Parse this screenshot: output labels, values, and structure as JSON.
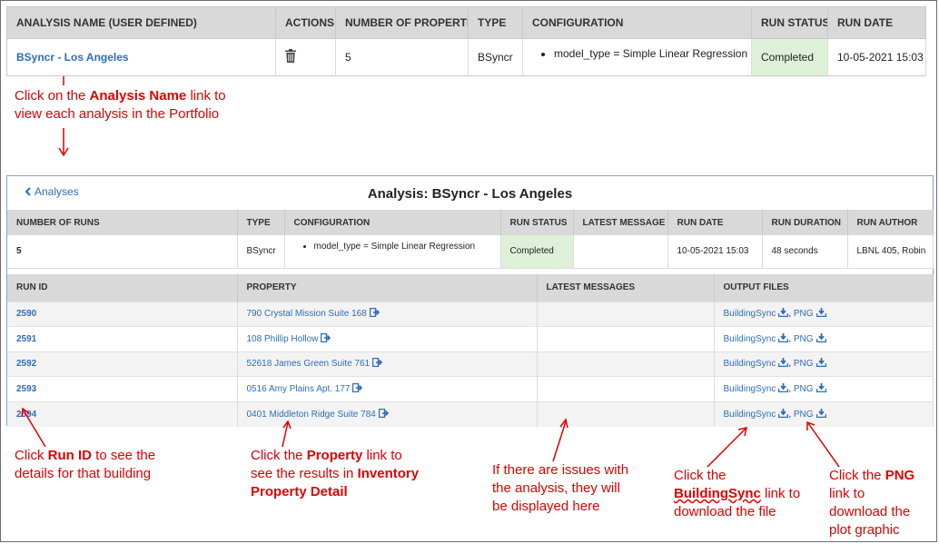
{
  "top_table": {
    "headers": [
      "ANALYSIS NAME (USER DEFINED)",
      "ACTIONS",
      "NUMBER OF PROPERTIES",
      "TYPE",
      "CONFIGURATION",
      "RUN STATUS",
      "RUN DATE"
    ],
    "row": {
      "name": "BSyncr - Los Angeles",
      "properties": "5",
      "type": "BSyncr",
      "configuration": "model_type = Simple Linear Regression",
      "status": "Completed",
      "date": "10-05-2021 15:03"
    }
  },
  "annotations": {
    "analysis_name": {
      "pre": "Click on the ",
      "bold": "Analysis Name",
      "post": " link to",
      "line2": "view each analysis in the Portfolio"
    },
    "run_id": {
      "pre": "Click ",
      "bold": "Run ID",
      "post": " to see the",
      "line2": "details for that building"
    },
    "property": {
      "pre": "Click the ",
      "bold": "Property",
      "post": " link to",
      "line2_pre": "see the results in ",
      "line2_bold": "Inventory",
      "line3_bold": "Property Detail"
    },
    "messages": {
      "line1": "If there are issues with",
      "line2": "the analysis, they will",
      "line3": "be displayed here"
    },
    "buildingsync": {
      "line1": "Click the",
      "line2_bold": "BuildingSync",
      "line2_post": " link to",
      "line3": "download the file"
    },
    "png": {
      "pre": "Click the ",
      "bold": "PNG",
      "line2": "link to",
      "line3": "download the",
      "line4": "plot graphic"
    }
  },
  "panel": {
    "back_label": "Analyses",
    "title": "Analysis: BSyncr - Los Angeles",
    "runs_headers": [
      "NUMBER OF RUNS",
      "TYPE",
      "CONFIGURATION",
      "RUN STATUS",
      "LATEST MESSAGE",
      "RUN DATE",
      "RUN DURATION",
      "RUN AUTHOR"
    ],
    "runs_row": {
      "runs": "5",
      "type": "BSyncr",
      "configuration": "model_type = Simple Linear Regression",
      "status": "Completed",
      "message": "",
      "date": "10-05-2021 15:03",
      "duration": "48 seconds",
      "author": "LBNL 405, Robin"
    },
    "files_headers": [
      "RUN ID",
      "PROPERTY",
      "LATEST MESSAGES",
      "OUTPUT FILES"
    ],
    "files_rows": [
      {
        "run_id": "2590",
        "property": "790 Crystal Mission Suite 168",
        "bsync": "BuildingSync",
        "png": "PNG"
      },
      {
        "run_id": "2591",
        "property": "108 Phillip Hollow",
        "bsync": "BuildingSync",
        "png": "PNG"
      },
      {
        "run_id": "2592",
        "property": "52618 James Green Suite 761",
        "bsync": "BuildingSync",
        "png": "PNG"
      },
      {
        "run_id": "2593",
        "property": "0516 Amy Plains Apt. 177",
        "bsync": "BuildingSync",
        "png": "PNG"
      },
      {
        "run_id": "2594",
        "property": "0401 Middleton Ridge Suite 784",
        "bsync": "BuildingSync",
        "png": "PNG"
      }
    ]
  },
  "icons": {
    "trash": "trash-icon",
    "external": "external-link-icon",
    "download": "download-icon",
    "back": "chevron-left-icon"
  },
  "colors": {
    "annotation": "#e00000",
    "link": "#2f6db5",
    "completed_bg": "#dff0d8",
    "header_bg": "#d9d9d9"
  }
}
